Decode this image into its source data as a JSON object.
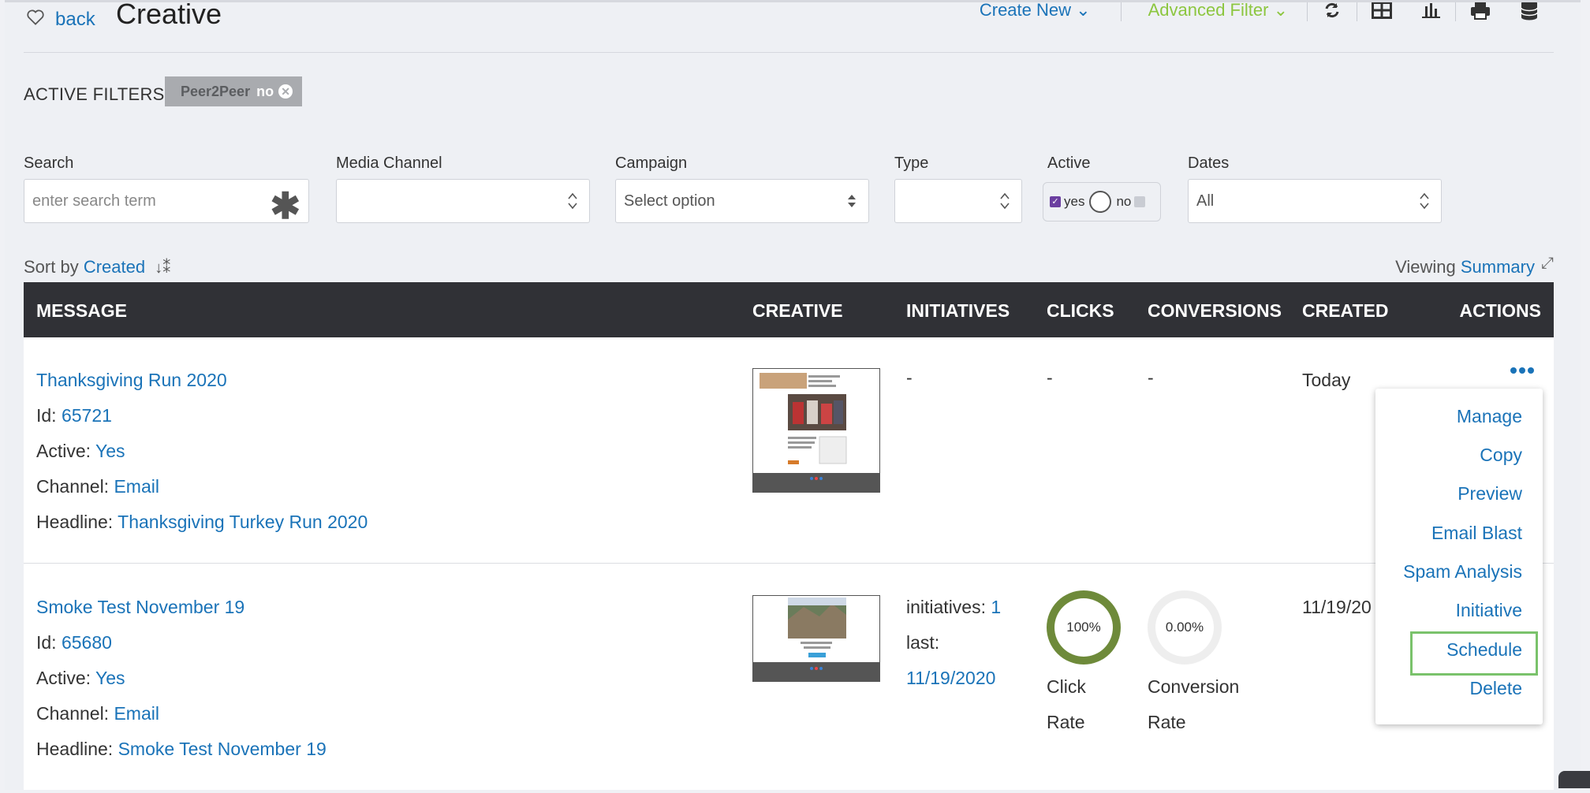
{
  "header": {
    "back_label": "back",
    "title": "Creative",
    "create_new_label": "Create New",
    "advanced_filter_label": "Advanced Filter",
    "tool_icons": [
      "refresh-icon",
      "grid-view-icon",
      "bar-chart-icon",
      "print-icon",
      "database-icon"
    ]
  },
  "active_filters": {
    "label": "ACTIVE FILTERS",
    "chip": {
      "name": "Peer2Peer",
      "value": "no",
      "remove_glyph": "✕"
    }
  },
  "filters": {
    "search": {
      "label": "Search",
      "placeholder": "enter search term"
    },
    "media_channel": {
      "label": "Media Channel",
      "value": ""
    },
    "campaign": {
      "label": "Campaign",
      "value": "Select option"
    },
    "type": {
      "label": "Type",
      "value": ""
    },
    "active": {
      "label": "Active",
      "yes_label": "yes",
      "no_label": "no",
      "yes_checked": true
    },
    "dates": {
      "label": "Dates",
      "value": "All"
    }
  },
  "sort": {
    "prefix": "Sort by",
    "field": "Created",
    "icon": "sort-desc-icon"
  },
  "viewing": {
    "prefix": "Viewing",
    "mode": "Summary",
    "icon": "expand-icon"
  },
  "table": {
    "columns": [
      "MESSAGE",
      "CREATIVE",
      "INITIATIVES",
      "CLICKS",
      "CONVERSIONS",
      "CREATED",
      "ACTIONS"
    ],
    "rows": [
      {
        "title": "Thanksgiving Run 2020",
        "id_label": "Id:",
        "id": "65721",
        "active_label": "Active:",
        "active": "Yes",
        "channel_label": "Channel:",
        "channel": "Email",
        "headline_label": "Headline:",
        "headline": "Thanksgiving Turkey Run 2020",
        "initiatives": "-",
        "clicks": "-",
        "conversions": "-",
        "created": "Today"
      },
      {
        "title": "Smoke Test November 19",
        "id_label": "Id:",
        "id": "65680",
        "active_label": "Active:",
        "active": "Yes",
        "channel_label": "Channel:",
        "channel": "Email",
        "headline_label": "Headline:",
        "headline": "Smoke Test November 19",
        "initiatives_label": "initiatives:",
        "initiatives_count": "1",
        "last_label": "last:",
        "last_date": "11/19/2020",
        "click_rate": "100%",
        "click_rate_value": 1.0,
        "click_rate_label_1": "Click",
        "click_rate_label_2": "Rate",
        "conversion_rate": "0.00%",
        "conversion_rate_value": 0.0,
        "conversion_rate_label_1": "Conversion",
        "conversion_rate_label_2": "Rate",
        "created": "11/19/20"
      }
    ]
  },
  "actions_menu": {
    "items": [
      "Manage",
      "Copy",
      "Preview",
      "Email Blast",
      "Spam Analysis",
      "Initiative",
      "Schedule",
      "Delete"
    ],
    "highlighted": "Schedule"
  },
  "colors": {
    "link": "#1a73b8",
    "advanced_filter": "#8cc63f",
    "table_header_bg": "#303136",
    "donut_full": "#6e8a3a",
    "donut_empty": "#eeeeee",
    "highlight_border": "#7ac26b"
  }
}
